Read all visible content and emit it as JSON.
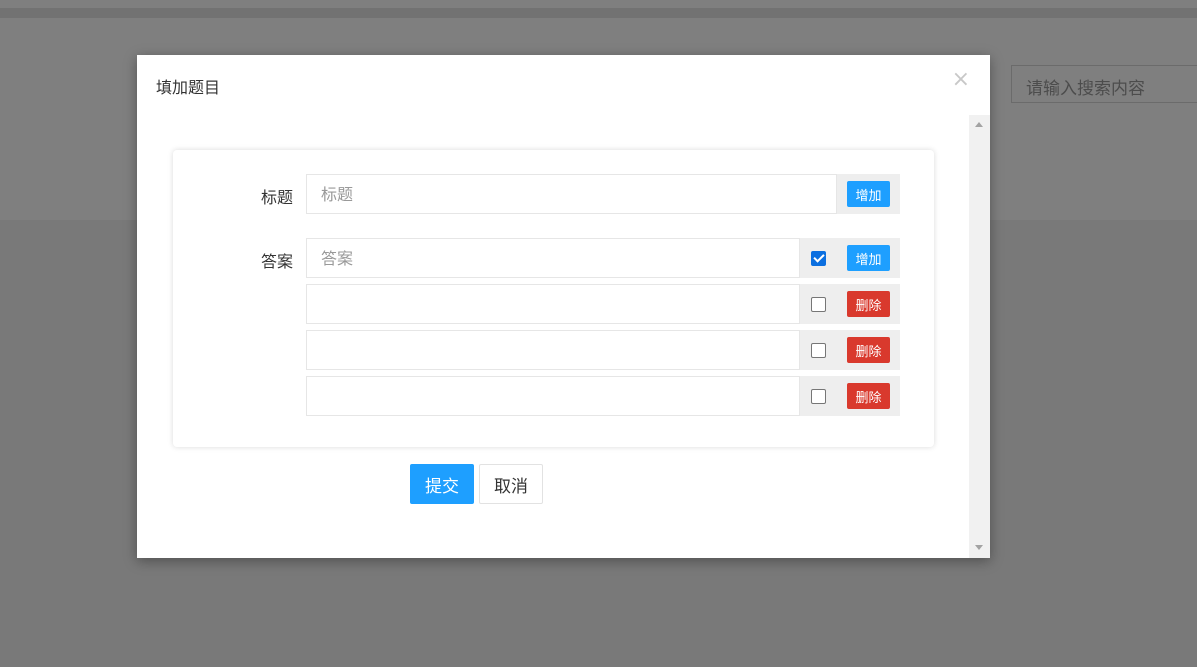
{
  "background": {
    "search_placeholder": "请输入搜索内容"
  },
  "modal": {
    "title": "填加题目",
    "close_glyph": "×",
    "form": {
      "title_label": "标题",
      "title_placeholder": "标题",
      "title_value": "",
      "title_add_button": "增加",
      "answer_label": "答案",
      "answers": [
        {
          "placeholder": "答案",
          "value": "",
          "checked": true,
          "button": "增加",
          "button_type": "add"
        },
        {
          "placeholder": "",
          "value": "",
          "checked": false,
          "button": "删除",
          "button_type": "delete"
        },
        {
          "placeholder": "",
          "value": "",
          "checked": false,
          "button": "删除",
          "button_type": "delete"
        },
        {
          "placeholder": "",
          "value": "",
          "checked": false,
          "button": "删除",
          "button_type": "delete"
        }
      ]
    },
    "submit_button": "提交",
    "cancel_button": "取消"
  },
  "colors": {
    "primary": "#1e9fff",
    "danger": "#d9392d",
    "checkbox_checked": "#0b6fe0",
    "overlay": "rgba(0,0,0,0.5)"
  },
  "icons": {
    "close": "close-icon",
    "scroll_up": "triangle-up-icon",
    "scroll_down": "triangle-down-icon",
    "check": "checkmark-icon"
  }
}
